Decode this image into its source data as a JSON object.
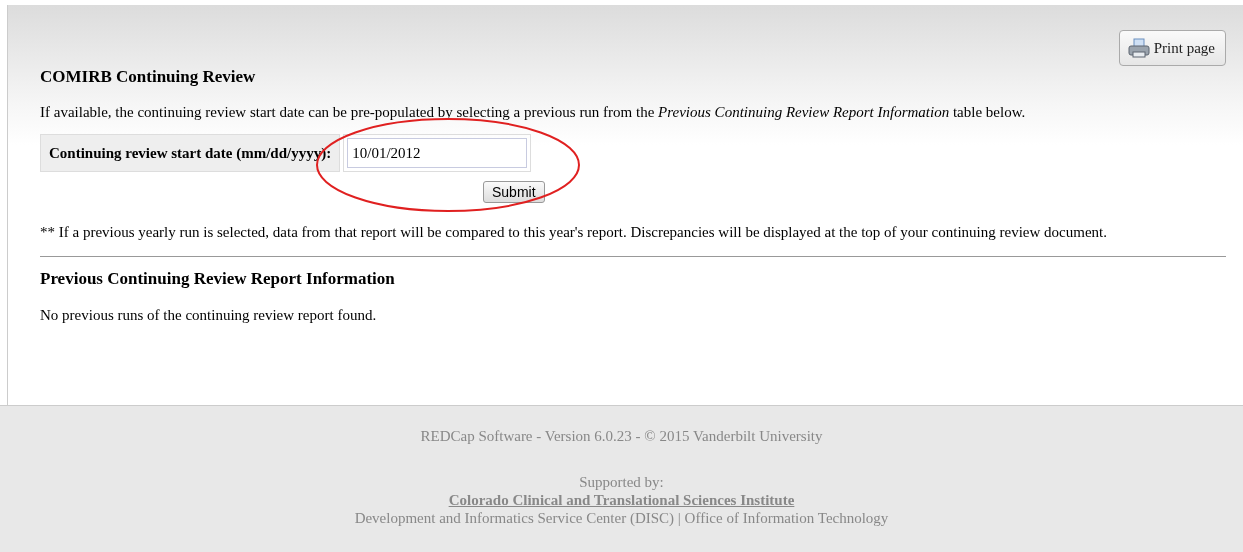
{
  "print_button": {
    "label": "Print page"
  },
  "title": "COMIRB Continuing Review",
  "intro": "If available, the continuing review start date can be pre-populated by selecting a previous run from the *Previous Continuing Review Report Information* table below.",
  "date_field": {
    "label": "Continuing review start date (mm/dd/yyyy):",
    "value": "10/01/2012"
  },
  "submit_button": {
    "label": "Submit"
  },
  "note": "** If a previous yearly run is selected, data from that report will be compared to this year's report. Discrepancies will be displayed at the top of your continuing review document.",
  "previous_section": {
    "title": "Previous Continuing Review Report Information",
    "message": "No previous runs of the continuing review report found."
  },
  "footer": {
    "version": "REDCap Software - Version 6.0.23 - © 2015 Vanderbilt University",
    "supported_by": "Supported by:",
    "institute_link": "Colorado Clinical and Translational Sciences Institute",
    "credits": "Development and Informatics Service Center (DISC) | Office of Information Technology"
  }
}
